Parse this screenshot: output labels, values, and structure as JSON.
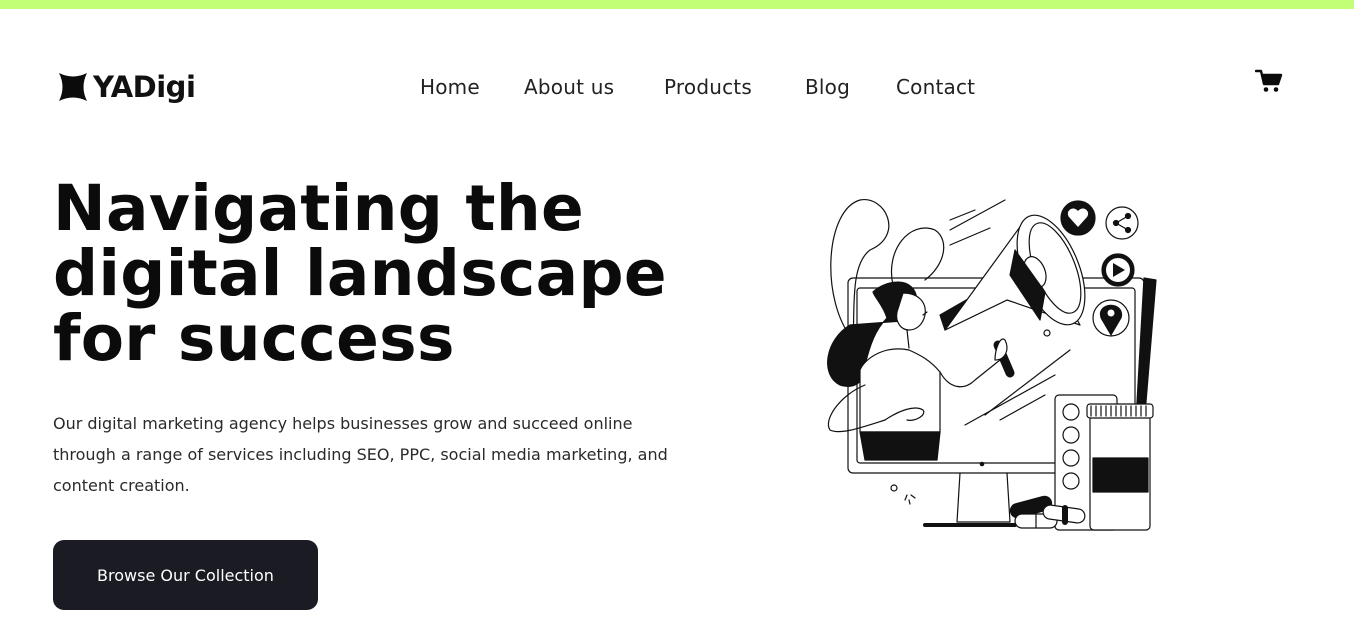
{
  "colors": {
    "accent": "#c3ff76",
    "text": "#0b0b0b",
    "button_bg": "#1b1b23",
    "button_text": "#ffffff"
  },
  "brand": {
    "name": "YADigi",
    "icon": "star-burst-icon"
  },
  "nav": {
    "items": [
      "Home",
      "About us",
      "Products",
      "Blog",
      "Contact"
    ]
  },
  "cart": {
    "icon": "shopping-cart-icon"
  },
  "hero": {
    "headline_lines": [
      "Navigating the",
      "digital landscape",
      "for success"
    ],
    "description": "Our digital marketing agency helps businesses grow and succeed online through a range of services including SEO, PPC, social media marketing, and content creation.",
    "cta_label": "Browse Our Collection",
    "illustration": "woman-with-megaphone-emerging-from-monitor-illustration",
    "illustration_icons": [
      "heart-icon",
      "share-icon",
      "play-icon",
      "location-pin-icon",
      "megaphone-icon",
      "pill-bottle-icon",
      "blister-pack-icon",
      "capsule-icon"
    ]
  }
}
